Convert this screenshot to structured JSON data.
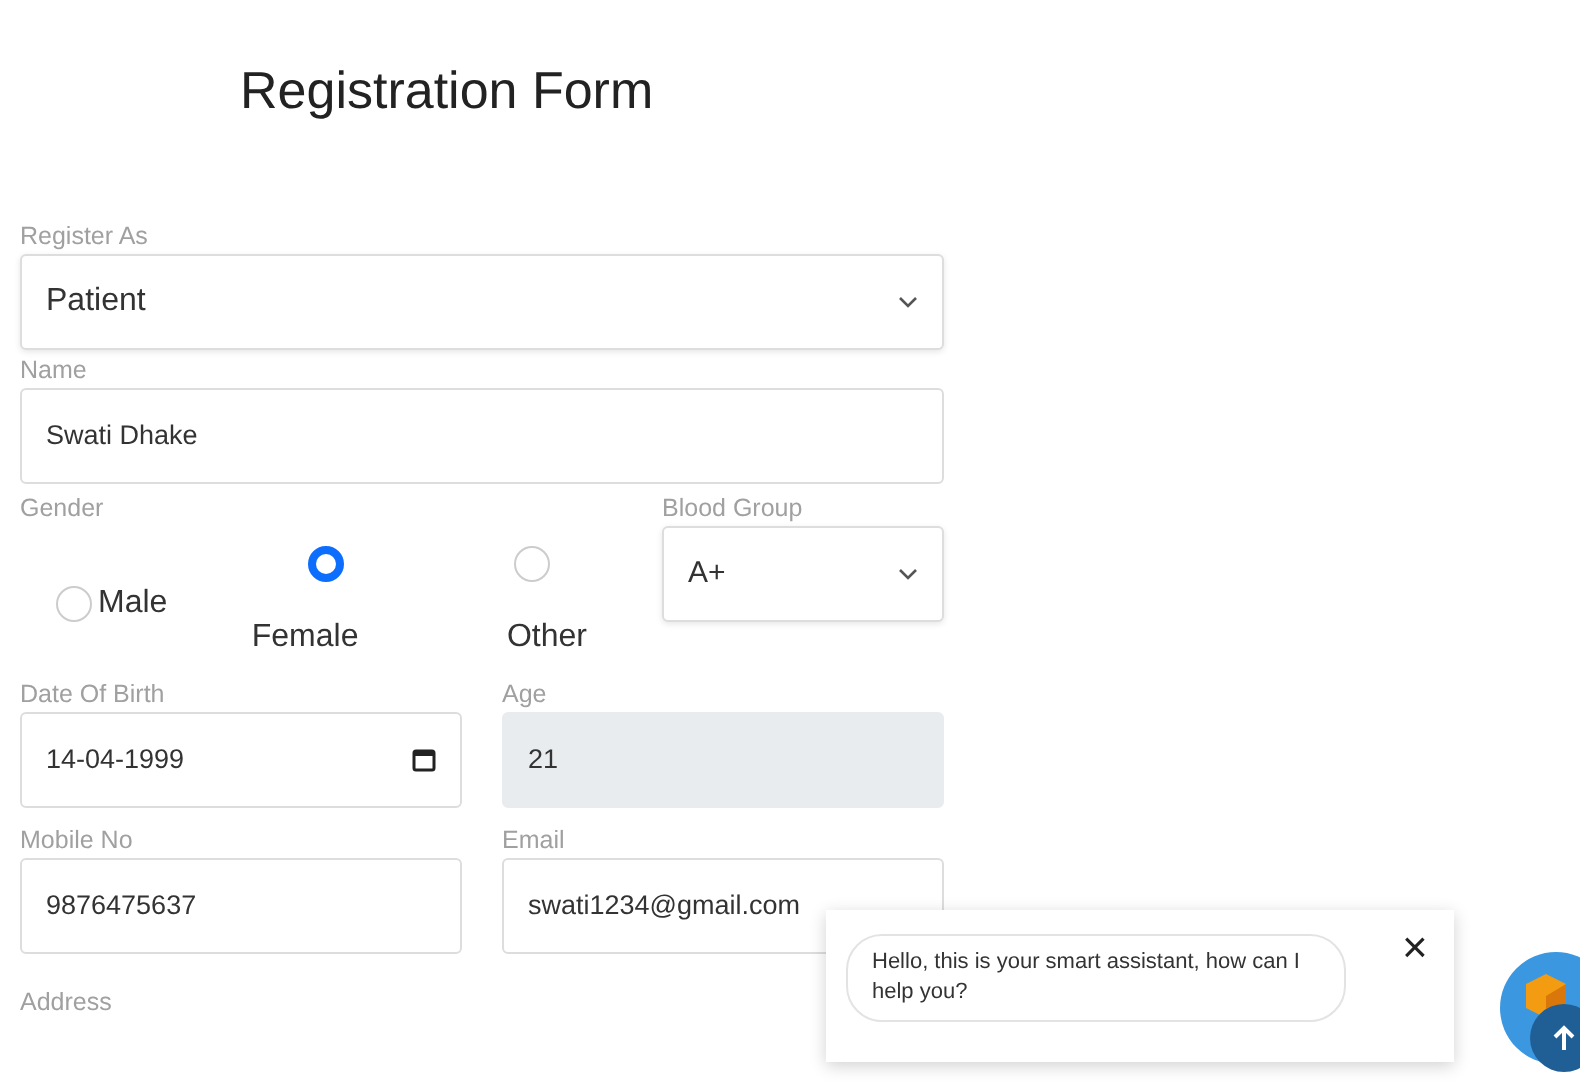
{
  "title": "Registration Form",
  "register_as": {
    "label": "Register As",
    "value": "Patient"
  },
  "name": {
    "label": "Name",
    "value": "Swati Dhake"
  },
  "gender": {
    "label": "Gender",
    "options": [
      {
        "label": "Male",
        "selected": false
      },
      {
        "label": "Female",
        "selected": true
      },
      {
        "label": "Other",
        "selected": false
      }
    ]
  },
  "blood_group": {
    "label": "Blood Group",
    "value": "A+"
  },
  "date_of_birth": {
    "label": "Date Of Birth",
    "value": "14-04-1999"
  },
  "age": {
    "label": "Age",
    "value": "21",
    "disabled": true
  },
  "mobile": {
    "label": "Mobile No",
    "value": "9876475637"
  },
  "email": {
    "label": "Email",
    "value": "swati1234@gmail.com"
  },
  "address": {
    "label": "Address"
  },
  "chat_popup": {
    "message": "Hello, this is your smart assistant, how can I help you?",
    "close": "×"
  }
}
